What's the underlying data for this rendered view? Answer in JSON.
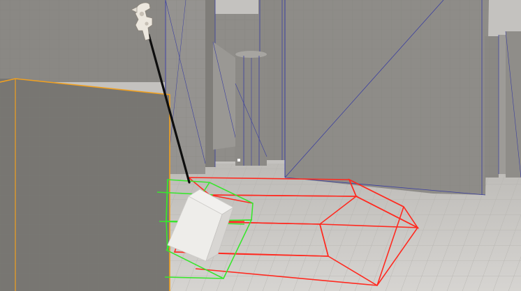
{
  "scene": {
    "kind": "3d-editor-viewport",
    "selected_object": "cube-block",
    "selection_outline_color": "#f0a020",
    "trace_color_hit": "#39e62e",
    "trace_color_miss": "#ff2a20",
    "wire_color": "#3a3ea0",
    "grab_tool": "claw-hand-icon"
  }
}
